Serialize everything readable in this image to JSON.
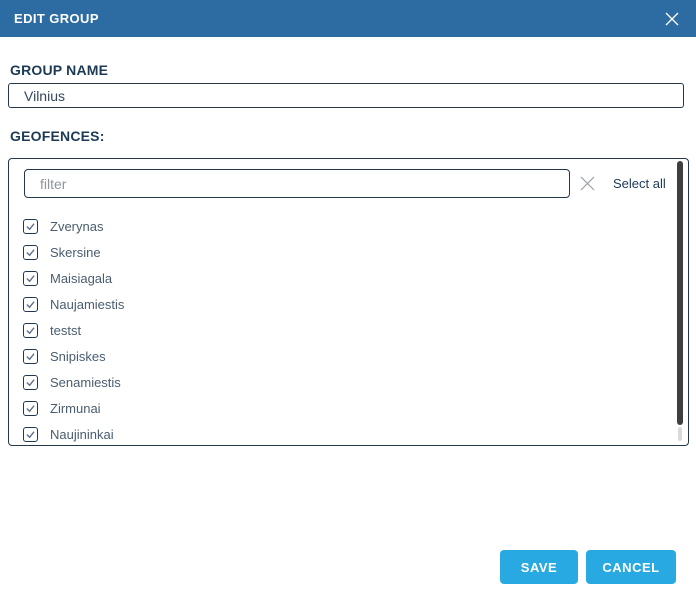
{
  "header": {
    "title": "EDIT GROUP",
    "close_icon": "x"
  },
  "form": {
    "group_name": {
      "label": "GROUP NAME",
      "value": "Vilnius"
    },
    "geofences": {
      "label": "GEOFENCES:",
      "filter": {
        "placeholder": "filter",
        "value": ""
      },
      "select_all_label": "Select all",
      "items": [
        {
          "label": "Zverynas",
          "checked": true
        },
        {
          "label": "Skersine",
          "checked": true
        },
        {
          "label": "Maisiagala",
          "checked": true
        },
        {
          "label": "Naujamiestis",
          "checked": true
        },
        {
          "label": "testst",
          "checked": true
        },
        {
          "label": "Snipiskes",
          "checked": true
        },
        {
          "label": "Senamiestis",
          "checked": true
        },
        {
          "label": "Zirmunai",
          "checked": true
        },
        {
          "label": "Naujininkai",
          "checked": true
        }
      ]
    }
  },
  "actions": {
    "save_label": "SAVE",
    "cancel_label": "CANCEL"
  },
  "colors": {
    "header_bg": "#2d6ca3",
    "button_bg": "#29a9e1",
    "label_text": "#1c3a54",
    "input_border": "#24384a",
    "item_text": "#4a5d6f",
    "check_mark": "#64748b",
    "scroll_thumb": "#3f3f3f"
  }
}
